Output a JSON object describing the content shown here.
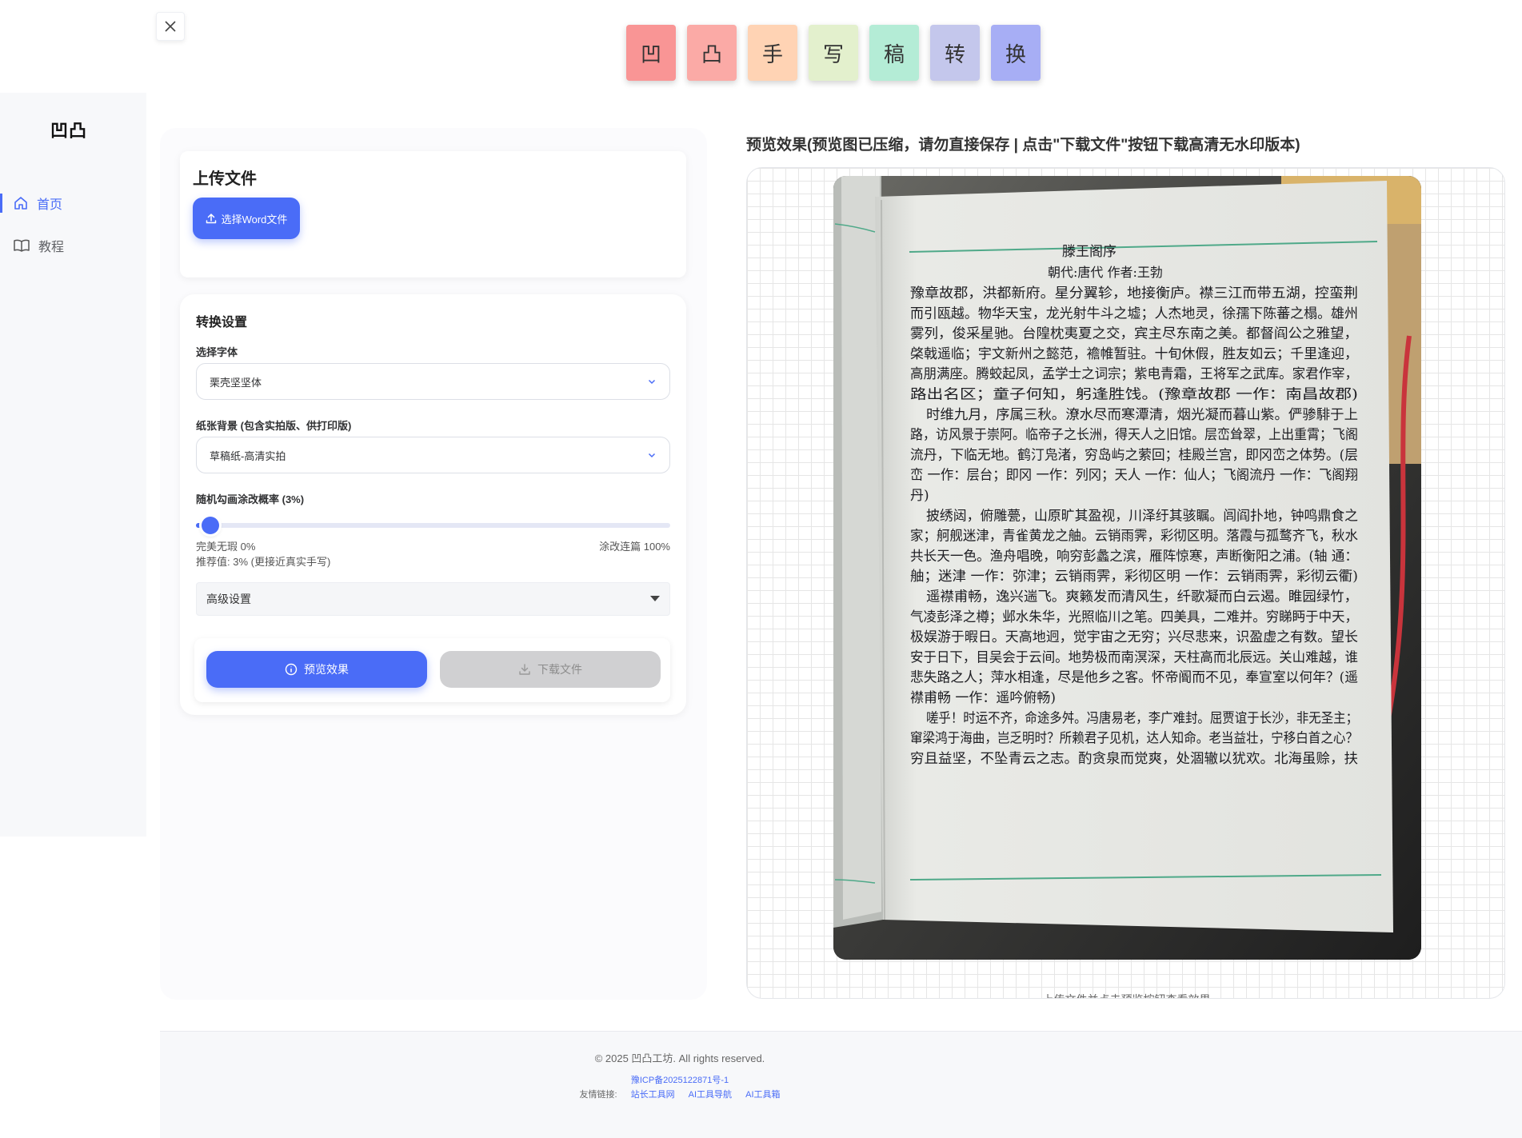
{
  "tiles": [
    {
      "char": "凹",
      "color": "#f99595"
    },
    {
      "char": "凸",
      "color": "#fbaaa6"
    },
    {
      "char": "手",
      "color": "#ffd3b4"
    },
    {
      "char": "写",
      "color": "#e3f0cd"
    },
    {
      "char": "稿",
      "color": "#b4ecd6"
    },
    {
      "char": "转",
      "color": "#c4c7ec"
    },
    {
      "char": "换",
      "color": "#a7aef5"
    }
  ],
  "sidebar": {
    "logo": "凹凸",
    "items": [
      {
        "label": "首页",
        "icon": "home-icon"
      },
      {
        "label": "教程",
        "icon": "book-icon"
      }
    ]
  },
  "upload": {
    "title": "上传文件",
    "button_label": "选择Word文件"
  },
  "settings": {
    "title": "转换设置",
    "font_label": "选择字体",
    "font_value": "栗壳坚坚体",
    "bg_label": "纸张背景 (包含实拍版、供打印版)",
    "bg_value": "草稿纸-高清实拍",
    "prob_label": "随机勾画涂改概率 (3%)",
    "prob_value": 0.03,
    "range_min_label": "完美无瑕 0%",
    "range_max_label": "涂改连篇 100%",
    "recommend": "推荐值: 3% (更接近真实手写)",
    "advanced_label": "高级设置",
    "preview_btn": "预览效果",
    "download_btn": "下载文件"
  },
  "preview": {
    "title": "预览效果(预览图已压缩，请勿直接保存 | 点击\"下载文件\"按钮下载高清无水印版本)",
    "caption": "上传文件并点击预览按钮查看效果",
    "page_title": "滕王阁序",
    "page_subtitle": "朝代:唐代 作者:王勃",
    "lines": [
      "豫章故郡，洪都新府。星分翼轸，地接衡庐。襟三江而带五湖，控蛮荆",
      "而引瓯越。物华天宝，龙光射牛斗之墟；人杰地灵，徐孺下陈蕃之榻。雄州",
      "雾列，俊采星驰。台隍枕夷夏之交，宾主尽东南之美。都督阎公之雅望，",
      "棨戟遥临；宇文新州之懿范，襜帷暂驻。十旬休假，胜友如云；千里逢迎，",
      "高朋满座。腾蛟起凤，孟学士之词宗；紫电青霜，王将军之武库。家君作宰，",
      "路出名区；童子何知，躬逢胜饯。(豫章故郡 一作：南昌故郡)",
      "时维九月，序属三秋。潦水尽而寒潭清，烟光凝而暮山紫。俨骖騑于上",
      "路，访风景于崇阿。临帝子之长洲，得天人之旧馆。层峦耸翠，上出重霄；飞阁",
      "流丹，下临无地。鹤汀凫渚，穷岛屿之萦回；桂殿兰宫，即冈峦之体势。(层",
      "峦 一作：层台；即冈 一作：列冈；天人 一作：仙人；飞阁流丹 一作：飞阁翔",
      "丹)",
      "披绣闼，俯雕甍，山原旷其盈视，川泽纡其骇瞩。闾阎扑地，钟鸣鼎食之",
      "家；舸舰迷津，青雀黄龙之舳。云销雨霁，彩彻区明。落霞与孤鹜齐飞，秋水",
      "共长天一色。渔舟唱晚，响穷彭蠡之滨，雁阵惊寒，声断衡阳之浦。(轴 通：",
      "舳；迷津 一作：弥津；云销雨霁，彩彻区明 一作：云销雨霁，彩彻云衢)",
      "遥襟甫畅，逸兴遄飞。爽籁发而清风生，纤歌凝而白云遏。睢园绿竹，",
      "气凌彭泽之樽；邺水朱华，光照临川之笔。四美具，二难并。穷睇眄于中天，",
      "极娱游于暇日。天高地迥，觉宇宙之无穷；兴尽悲来，识盈虚之有数。望长",
      "安于日下，目吴会于云间。地势极而南溟深，天柱高而北辰远。关山难越，谁",
      "悲失路之人；萍水相逢，尽是他乡之客。怀帝阍而不见，奉宣室以何年？(遥",
      "襟甫畅 一作：遥吟俯畅)",
      "嗟乎！时运不齐，命途多舛。冯唐易老，李广难封。屈贾谊于长沙，非无圣主；",
      "窜梁鸿于海曲，岂乏明时？所赖君子见机，达人知命。老当益壮，宁移白首之心？",
      "穷且益坚，不坠青云之志。酌贪泉而觉爽，处涸辙以犹欢。北海虽赊，扶"
    ]
  },
  "footer": {
    "copyright": "© 2025 凹凸工坊. All rights reserved.",
    "icp": "豫ICP备2025122871号-1",
    "links_label": "友情链接:",
    "links": [
      "站长工具网",
      "AI工具导航",
      "AI工具箱"
    ]
  }
}
